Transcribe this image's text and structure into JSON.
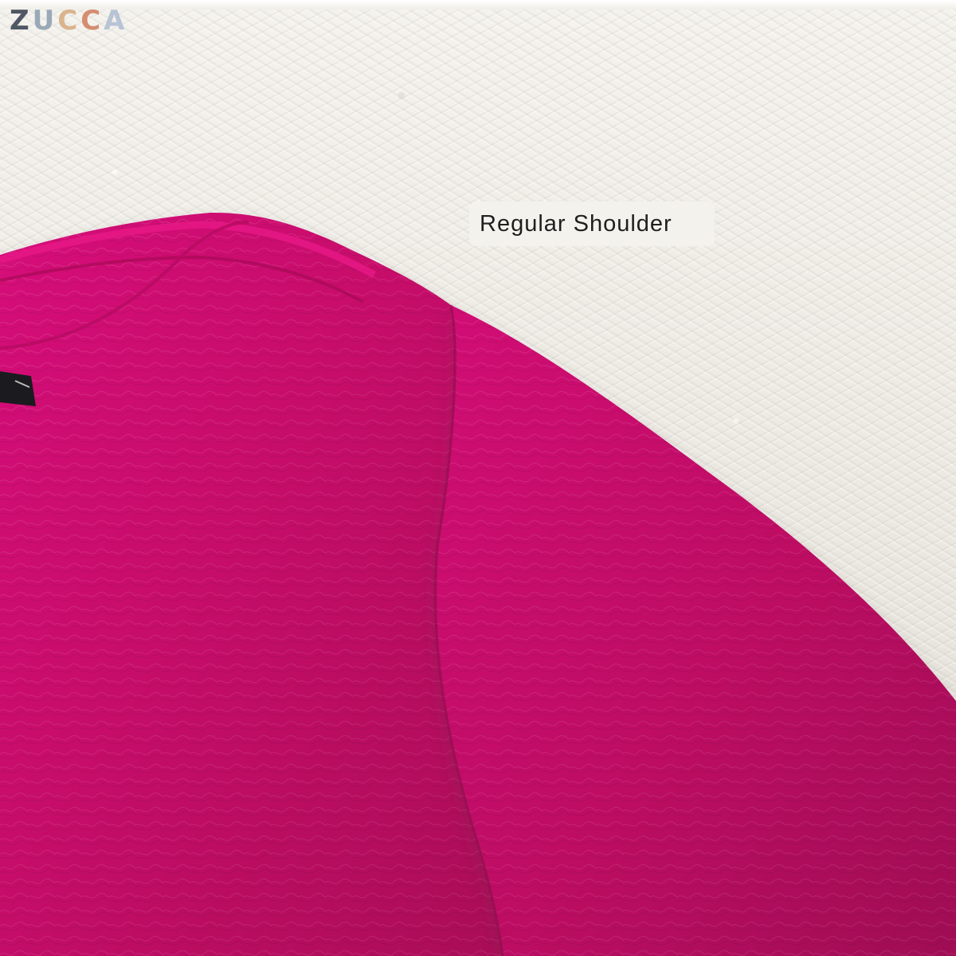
{
  "brand": {
    "logo_text": "ZUCCA"
  },
  "annotation": {
    "label": "Regular Shoulder"
  },
  "colors": {
    "garment": "#c40a68",
    "rug": "#efece6",
    "label_background": "#f3f2ed",
    "label_text": "#1f1f1f"
  },
  "icons": {
    "product": "pink-blouse-photo",
    "tag": "clothing-tag-icon"
  }
}
